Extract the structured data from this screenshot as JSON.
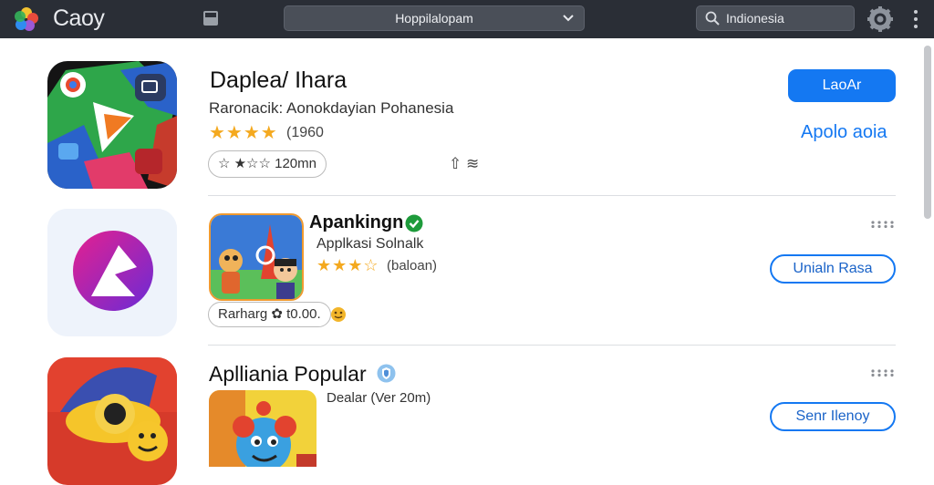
{
  "header": {
    "brand": "Caoy",
    "dropdown_label": "Hoppilalopam",
    "search_value": "Indionesia"
  },
  "featured": {
    "title": "Daplea/ Ihara",
    "subtitle": "Raronacik: Aonokdayian Pohanesia",
    "rating_stars": "★★★★",
    "rating_count": "(1960",
    "size_pill": "☆ ★☆☆ 120mn",
    "extra_glyphs": "⇧ ≋",
    "primary_button": "LaoAr",
    "secondary_link": "Apolo aoia"
  },
  "items": [
    {
      "title": "Apankingn",
      "subtitle": "Applkasi Solnalk",
      "rating_stars": "★★★☆",
      "rating_text": "(baloan)",
      "pill": "Rarharg ✿ t0.00.",
      "button": "Unialn Rasa"
    },
    {
      "title": "Aplliania Popular",
      "subtitle": "Dealar (Ver 20m)",
      "button": "Senr Ilenoy"
    }
  ]
}
